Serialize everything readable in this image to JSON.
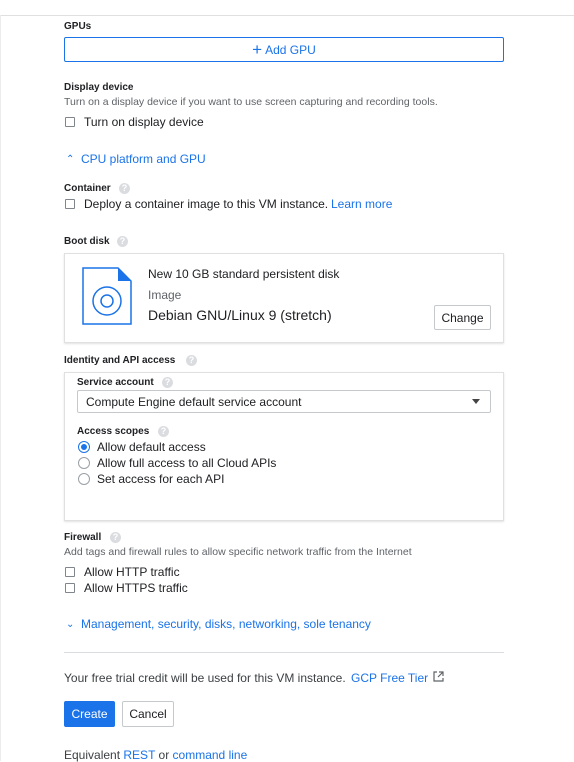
{
  "gpus": {
    "label": "GPUs",
    "add_label": "Add GPU"
  },
  "display_device": {
    "label": "Display device",
    "description": "Turn on a display device if you want to use screen capturing and recording tools.",
    "checkbox_label": "Turn on display device"
  },
  "cpu_platform": {
    "label": "CPU platform and GPU"
  },
  "container": {
    "label": "Container",
    "checkbox_label": "Deploy a container image to this VM instance.",
    "learn_more": "Learn more"
  },
  "boot_disk": {
    "label": "Boot disk",
    "title": "New 10 GB standard persistent disk",
    "image_label": "Image",
    "image_value": "Debian GNU/Linux 9 (stretch)",
    "change_label": "Change"
  },
  "identity": {
    "label": "Identity and API access",
    "service_account_label": "Service account",
    "service_account_value": "Compute Engine default service account",
    "access_scopes_label": "Access scopes",
    "scopes": [
      {
        "label": "Allow default access",
        "selected": true
      },
      {
        "label": "Allow full access to all Cloud APIs",
        "selected": false
      },
      {
        "label": "Set access for each API",
        "selected": false
      }
    ]
  },
  "firewall": {
    "label": "Firewall",
    "description": "Add tags and firewall rules to allow specific network traffic from the Internet",
    "http_label": "Allow HTTP traffic",
    "https_label": "Allow HTTPS traffic"
  },
  "management": {
    "label": "Management, security, disks, networking, sole tenancy"
  },
  "trial": {
    "text": "Your free trial credit will be used for this VM instance.",
    "link": "GCP Free Tier"
  },
  "actions": {
    "create_label": "Create",
    "cancel_label": "Cancel"
  },
  "footer": {
    "prefix": "Equivalent",
    "rest": "REST",
    "or": "or",
    "command_line": "command line"
  },
  "colors": {
    "accent": "#1a73e8",
    "text": "#202124",
    "secondary": "#5f6368"
  }
}
